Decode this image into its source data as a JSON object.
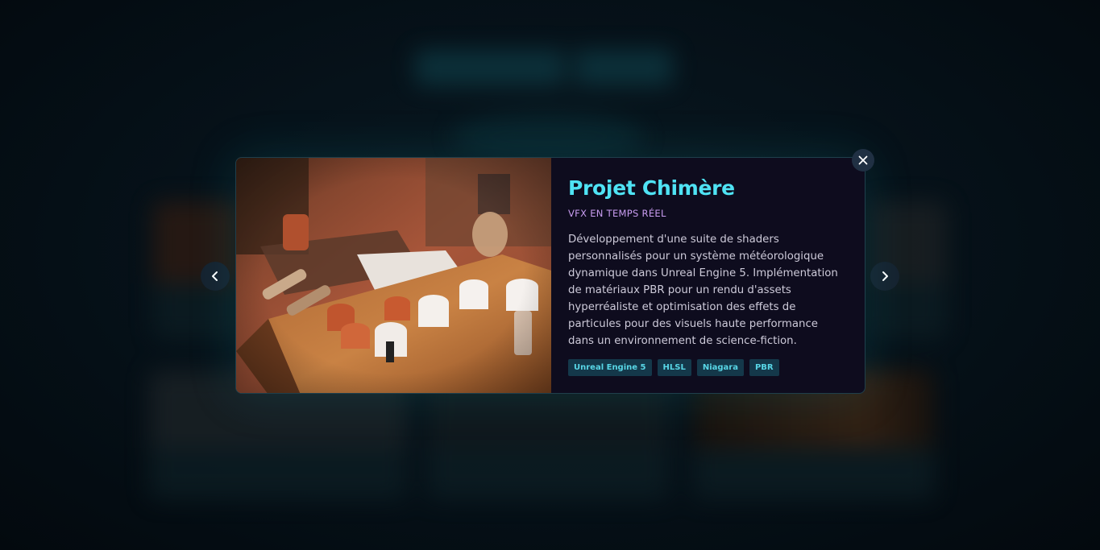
{
  "modal": {
    "title": "Projet Chimère",
    "category": "VFX EN TEMPS RÉEL",
    "description": "Développement d'une suite de shaders personnalisés pour un système météorologique dynamique dans Unreal Engine 5. Implémentation de matériaux PBR pour un rendu d'assets hyperréaliste et optimisation des effets de particules pour des visuels haute performance dans un environnement de science-fiction.",
    "tags": [
      "Unreal Engine 5",
      "HLSL",
      "Niagara",
      "PBR"
    ],
    "image_subject": "photo-enamel-cups-on-wooden-table"
  },
  "controls": {
    "close_icon": "close-icon",
    "prev_icon": "chevron-left-icon",
    "next_icon": "chevron-right-icon"
  },
  "colors": {
    "accent_title": "#4fe3f4",
    "accent_category": "#c89cf0",
    "tag_text": "#58d6e6",
    "tag_background": "#14384a",
    "modal_background": "#0e0c1e",
    "backdrop": "#050c12"
  }
}
